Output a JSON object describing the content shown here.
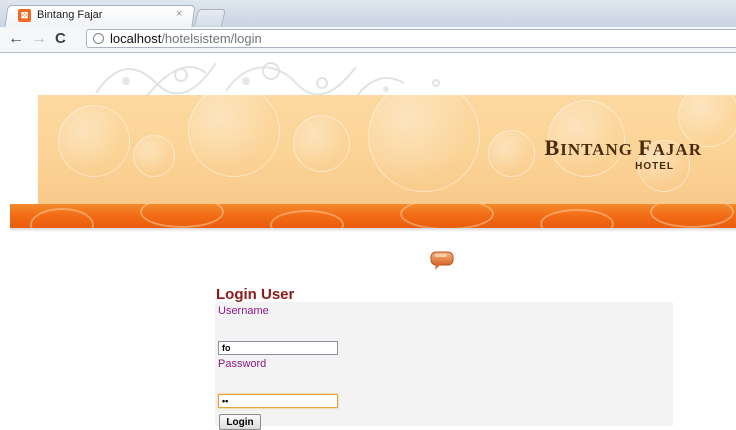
{
  "browser": {
    "tab_title": "Bintang Fajar",
    "tab_close": "×",
    "url_host": "localhost",
    "url_path": "/hotelsistem/login",
    "back_glyph": "←",
    "forward_glyph": "→",
    "reload_glyph": "C"
  },
  "header": {
    "brand_b": "B",
    "brand_intang": "INTANG ",
    "brand_f": "F",
    "brand_ajar": "AJAR",
    "subtitle": "HOTEL"
  },
  "icons": {
    "favicon": "hotel-favicon-icon",
    "chat": "speech-bubble-icon",
    "globe": "globe-icon"
  },
  "login": {
    "title": "Login User",
    "username_label": "Username",
    "username_value": "fo",
    "password_label": "Password",
    "password_value": "••",
    "button_label": "Login"
  },
  "colors": {
    "banner": "#fbd396",
    "band": "#f26b15",
    "brand_text": "#4b2a0c",
    "login_title": "#8b1a1a",
    "field_label": "#8a1a8a"
  }
}
